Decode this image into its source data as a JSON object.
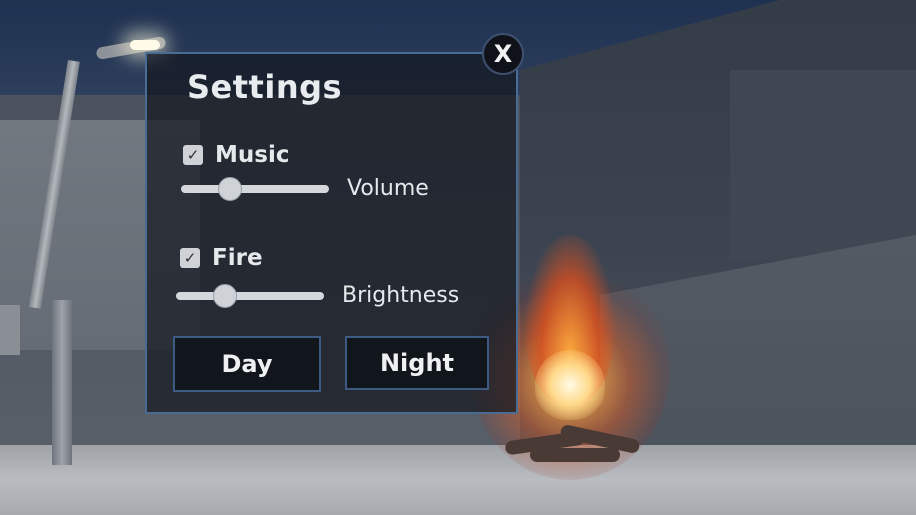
{
  "settings": {
    "title": "Settings",
    "close_label": "X",
    "music": {
      "label": "Music",
      "checked": true,
      "check_glyph": "✓"
    },
    "volume": {
      "label": "Volume",
      "value": 0.3
    },
    "fire": {
      "label": "Fire",
      "checked": true,
      "check_glyph": "✓"
    },
    "brightness": {
      "label": "Brightness",
      "value": 0.3
    },
    "day_button": "Day",
    "night_button": "Night"
  },
  "colors": {
    "panel_border": "#4a6b94",
    "button_border": "#3c5a82",
    "text": "#e9ecef"
  },
  "icons": {
    "close": "close-icon",
    "checkbox": "check-icon"
  }
}
